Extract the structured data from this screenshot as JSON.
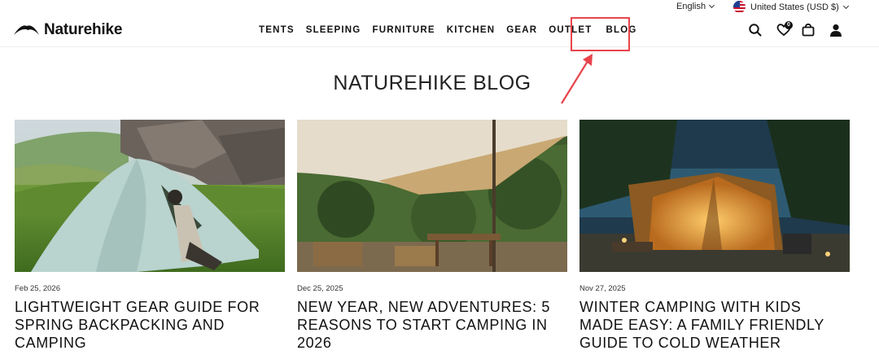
{
  "topbar": {
    "language": "English",
    "currency": "United States (USD $)"
  },
  "header": {
    "brand": "Naturehike",
    "nav": [
      "TENTS",
      "SLEEPING",
      "FURNITURE",
      "KITCHEN",
      "GEAR",
      "OUTLET",
      "BLOG"
    ],
    "wishlist_count": "0",
    "icons": [
      "search-icon",
      "heart-icon",
      "bag-icon",
      "account-icon"
    ]
  },
  "page": {
    "title": "NATUREHIKE BLOG"
  },
  "posts": [
    {
      "date": "Feb 25, 2026",
      "title": "LIGHTWEIGHT GEAR GUIDE FOR SPRING BACKPACKING AND CAMPING"
    },
    {
      "date": "Dec 25, 2025",
      "title": "NEW YEAR, NEW ADVENTURES: 5 REASONS TO START CAMPING IN 2026"
    },
    {
      "date": "Nov 27, 2025",
      "title": "WINTER CAMPING WITH KIDS MADE EASY: A FAMILY FRIENDLY GUIDE TO COLD WEATHER ADVENTURES"
    }
  ],
  "annotation_color": "#e8444c"
}
